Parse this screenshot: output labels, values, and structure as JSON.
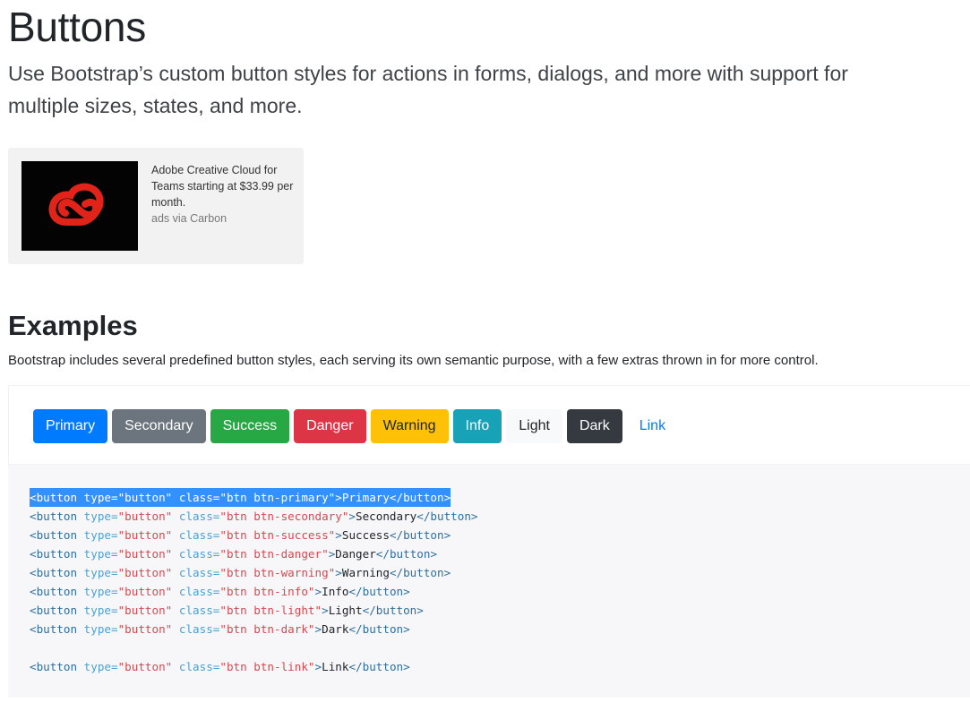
{
  "header": {
    "title": "Buttons",
    "lead": "Use Bootstrap’s custom button styles for actions in forms, dialogs, and more with support for multiple sizes, states, and more."
  },
  "ad": {
    "text": "Adobe Creative Cloud for Teams starting at $33.99 per month.",
    "by": "ads via Carbon",
    "logo_color": "#e2231a"
  },
  "examples": {
    "title": "Examples",
    "description": "Bootstrap includes several predefined button styles, each serving its own semantic purpose, with a few extras thrown in for more control.",
    "buttons": [
      {
        "label": "Primary",
        "variant": "primary"
      },
      {
        "label": "Secondary",
        "variant": "secondary"
      },
      {
        "label": "Success",
        "variant": "success"
      },
      {
        "label": "Danger",
        "variant": "danger"
      },
      {
        "label": "Warning",
        "variant": "warning"
      },
      {
        "label": "Info",
        "variant": "info"
      },
      {
        "label": "Light",
        "variant": "light"
      },
      {
        "label": "Dark",
        "variant": "dark"
      },
      {
        "label": "Link",
        "variant": "link"
      }
    ]
  },
  "code": {
    "open_tag": "<button",
    "type_attr": "type=",
    "type_val": "\"button\"",
    "class_attr": "class=",
    "close_tag": "</button>",
    "lines": [
      {
        "cls": "\"btn btn-primary\"",
        "label": "Primary",
        "selected": true
      },
      {
        "cls": "\"btn btn-secondary\"",
        "label": "Secondary"
      },
      {
        "cls": "\"btn btn-success\"",
        "label": "Success"
      },
      {
        "cls": "\"btn btn-danger\"",
        "label": "Danger"
      },
      {
        "cls": "\"btn btn-warning\"",
        "label": "Warning"
      },
      {
        "cls": "\"btn btn-info\"",
        "label": "Info"
      },
      {
        "cls": "\"btn btn-light\"",
        "label": "Light"
      },
      {
        "cls": "\"btn btn-dark\"",
        "label": "Dark"
      },
      {
        "blank": true
      },
      {
        "cls": "\"btn btn-link\"",
        "label": "Link"
      }
    ]
  }
}
